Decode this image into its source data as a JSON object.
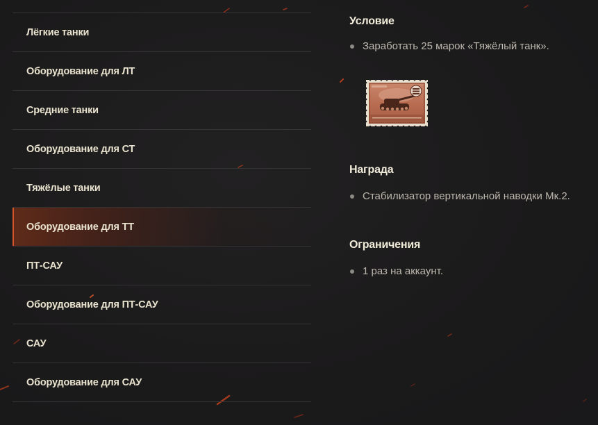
{
  "menu": {
    "items": [
      {
        "label": "Лёгкие танки",
        "active": false
      },
      {
        "label": "Оборудование для ЛТ",
        "active": false
      },
      {
        "label": "Средние танки",
        "active": false
      },
      {
        "label": "Оборудование для СТ",
        "active": false
      },
      {
        "label": "Тяжёлые танки",
        "active": false
      },
      {
        "label": "Оборудование для ТТ",
        "active": true
      },
      {
        "label": "ПТ-САУ",
        "active": false
      },
      {
        "label": "Оборудование для ПТ-САУ",
        "active": false
      },
      {
        "label": "САУ",
        "active": false
      },
      {
        "label": "Оборудование для САУ",
        "active": false
      }
    ]
  },
  "condition": {
    "title": "Условие",
    "text": "Заработать 25 марок «Тяжёлый танк».",
    "stamp_icon": "heavy-tank-stamp-icon"
  },
  "reward": {
    "title": "Награда",
    "text": "Стабилизатор вертикальной наводки Мк.2."
  },
  "limits": {
    "title": "Ограничения",
    "text": "1 раз на аккаунт."
  },
  "colors": {
    "background": "#1c1b1c",
    "accent": "#d2562a",
    "menu_text": "#e9e3cf",
    "body_text": "#bcb8ae"
  }
}
